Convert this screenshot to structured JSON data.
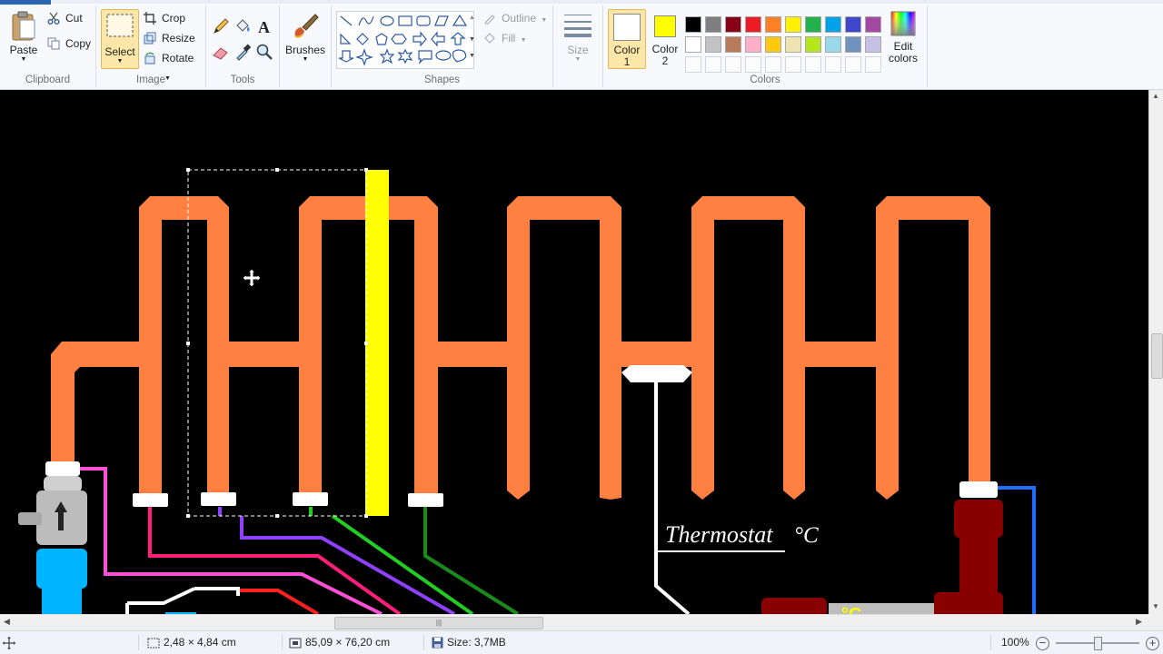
{
  "ribbon": {
    "clipboard": {
      "group_label": "Clipboard",
      "paste": "Paste",
      "cut": "Cut",
      "copy": "Copy"
    },
    "image": {
      "group_label": "Image",
      "select": "Select",
      "crop": "Crop",
      "resize": "Resize",
      "rotate": "Rotate"
    },
    "tools": {
      "group_label": "Tools"
    },
    "brushes": {
      "label": "Brushes"
    },
    "shapes": {
      "group_label": "Shapes",
      "outline": "Outline",
      "fill": "Fill"
    },
    "size": {
      "label": "Size"
    },
    "color1": {
      "label_line1": "Color",
      "label_line2": "1",
      "color": "#ffffff"
    },
    "color2": {
      "label_line1": "Color",
      "label_line2": "2",
      "color": "#ffff00"
    },
    "colors": {
      "group_label": "Colors",
      "edit_line1": "Edit",
      "edit_line2": "colors",
      "palette_row1": [
        "#000000",
        "#7f7f7f",
        "#880015",
        "#ed1c24",
        "#ff7f27",
        "#fff200",
        "#22b14c",
        "#00a2e8",
        "#3f48cc",
        "#a349a4"
      ],
      "palette_row2": [
        "#ffffff",
        "#c3c3c3",
        "#b97a57",
        "#ffaec9",
        "#ffc90e",
        "#efe4b0",
        "#b5e61d",
        "#99d9ea",
        "#7092be",
        "#c8bfe7"
      ]
    }
  },
  "canvas": {
    "thermostat_label": "Thermostat",
    "unit_label": "°C",
    "pipe_color": "#ff8040",
    "highlight_color": "#ffff00"
  },
  "statusbar": {
    "selection_size": "2,48 × 4,84 cm",
    "image_size": "85,09 × 76,20 cm",
    "file_size": "Size: 3,7MB",
    "zoom": "100%"
  }
}
